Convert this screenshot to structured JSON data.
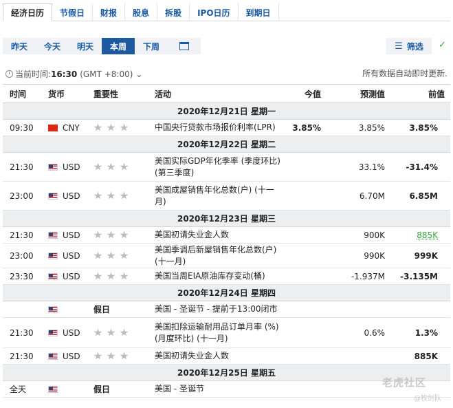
{
  "top_tabs": [
    "经济日历",
    "节假日",
    "财报",
    "股息",
    "拆股",
    "IPO日历",
    "到期日"
  ],
  "day_tabs": [
    "昨天",
    "今天",
    "明天",
    "本周",
    "下周"
  ],
  "filter_label": "筛选",
  "time": {
    "label": "当前时间:",
    "value": "16:30",
    "tz": "(GMT +8:00)"
  },
  "auto_update": "所有数据自动即时更新.",
  "headers": {
    "time": "时间",
    "currency": "货币",
    "importance": "重要性",
    "activity": "活动",
    "actual": "今值",
    "forecast": "预测值",
    "previous": "前值"
  },
  "sections": [
    {
      "date": "2020年12月21日  星期一",
      "rows": [
        {
          "time": "09:30",
          "flag": "cn",
          "currency": "CNY",
          "holiday": "",
          "activity": "中国央行贷款市场报价利率(LPR)",
          "actual": "3.85%",
          "forecast": "3.85%",
          "previous": "3.85%",
          "prev_style": "bold"
        }
      ]
    },
    {
      "date": "2020年12月22日  星期二",
      "rows": [
        {
          "time": "21:30",
          "flag": "us",
          "currency": "USD",
          "holiday": "",
          "activity": "美国实际GDP年化季率 (季度环比) (第三季度)",
          "actual": "",
          "forecast": "33.1%",
          "previous": "-31.4%",
          "prev_style": "bold"
        },
        {
          "time": "23:00",
          "flag": "us",
          "currency": "USD",
          "holiday": "",
          "activity": "美国成屋销售年化总数(户) (十一月)",
          "actual": "",
          "forecast": "6.70M",
          "previous": "6.85M",
          "prev_style": "bold"
        }
      ]
    },
    {
      "date": "2020年12月23日  星期三",
      "rows": [
        {
          "time": "21:30",
          "flag": "us",
          "currency": "USD",
          "holiday": "",
          "activity": "美国初请失业金人数",
          "actual": "",
          "forecast": "900K",
          "previous": "885K",
          "prev_style": "green"
        },
        {
          "time": "23:00",
          "flag": "us",
          "currency": "USD",
          "holiday": "",
          "activity": "美国季调后新屋销售年化总数(户) (十一月)",
          "actual": "",
          "forecast": "990K",
          "previous": "999K",
          "prev_style": "bold"
        },
        {
          "time": "23:30",
          "flag": "us",
          "currency": "USD",
          "holiday": "",
          "activity": "美国当周EIA原油库存变动(桶)",
          "actual": "",
          "forecast": "-1.937M",
          "previous": "-3.135M",
          "prev_style": "bold"
        }
      ]
    },
    {
      "date": "2020年12月24日  星期四",
      "rows": [
        {
          "time": "",
          "flag": "us",
          "currency": "",
          "holiday": "假日",
          "activity": "美国 - 圣诞节 - 提前于13:00闭市",
          "actual": "",
          "forecast": "",
          "previous": "",
          "prev_style": ""
        },
        {
          "time": "21:30",
          "flag": "us",
          "currency": "USD",
          "holiday": "",
          "activity": "美国扣除运输耐用品订单月率 (%) (月度环比) (十一月)",
          "actual": "",
          "forecast": "0.6%",
          "previous": "1.3%",
          "prev_style": "bold"
        },
        {
          "time": "21:30",
          "flag": "us",
          "currency": "USD",
          "holiday": "",
          "activity": "美国初请失业金人数",
          "actual": "",
          "forecast": "",
          "previous": "885K",
          "prev_style": "bold"
        }
      ]
    },
    {
      "date": "2020年12月25日  星期五",
      "rows": [
        {
          "time": "全天",
          "flag": "us",
          "currency": "",
          "holiday": "假日",
          "activity": "美国 - 圣诞节",
          "actual": "",
          "forecast": "",
          "previous": "",
          "prev_style": ""
        }
      ]
    }
  ],
  "watermark": "老虎社区",
  "watermark_sub": "@牧剑队"
}
